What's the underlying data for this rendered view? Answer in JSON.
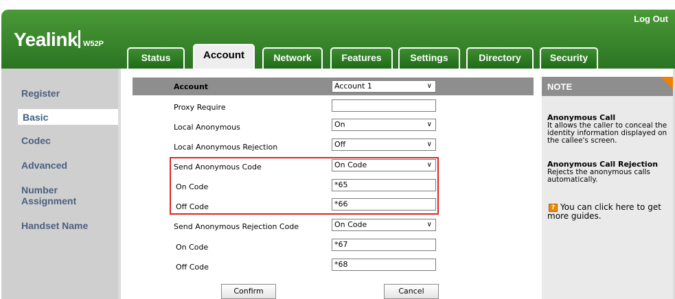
{
  "brand": {
    "logo": "Yealink",
    "model": "W52P"
  },
  "header": {
    "logout": "Log Out"
  },
  "tabs": [
    {
      "label": "Status"
    },
    {
      "label": "Account"
    },
    {
      "label": "Network"
    },
    {
      "label": "Features"
    },
    {
      "label": "Settings"
    },
    {
      "label": "Directory"
    },
    {
      "label": "Security"
    }
  ],
  "active_tab": "Account",
  "sidebar": {
    "items": [
      {
        "label": "Register"
      },
      {
        "label": "Basic"
      },
      {
        "label": "Codec"
      },
      {
        "label": "Advanced"
      },
      {
        "label": "Number Assignment"
      },
      {
        "label": "Handset Name"
      }
    ],
    "active": "Basic"
  },
  "form": {
    "account": {
      "label": "Account",
      "value": "Account 1"
    },
    "proxy_require": {
      "label": "Proxy Require",
      "value": ""
    },
    "local_anonymous": {
      "label": "Local Anonymous",
      "value": "On"
    },
    "local_anonymous_rejection": {
      "label": "Local Anonymous Rejection",
      "value": "Off"
    },
    "send_anonymous_code": {
      "label": "Send Anonymous Code",
      "value": "On Code"
    },
    "on_code_1": {
      "label": "On Code",
      "value": "*65"
    },
    "off_code_1": {
      "label": "Off Code",
      "value": "*66"
    },
    "send_anonymous_rejection_code": {
      "label": "Send Anonymous Rejection Code",
      "value": "On Code"
    },
    "on_code_2": {
      "label": "On Code",
      "value": "*67"
    },
    "off_code_2": {
      "label": "Off Code",
      "value": "*68"
    },
    "confirm": "Confirm",
    "cancel": "Cancel"
  },
  "note": {
    "title": "NOTE",
    "sections": [
      {
        "heading": "Anonymous Call",
        "text": "It allows the caller to conceal the identity information displayed on the callee's screen."
      },
      {
        "heading": "Anonymous Call Rejection",
        "text": "Rejects the anonymous calls automatically."
      }
    ],
    "guide": "You can click here to get more guides."
  },
  "colors": {
    "header_green": "#2b7422",
    "highlight": "#e02020",
    "nav_text": "#4a6080",
    "note_corner": "#f08000"
  },
  "icons": {
    "dropdown": "chevron-down-icon",
    "guide": "guide-icon"
  }
}
